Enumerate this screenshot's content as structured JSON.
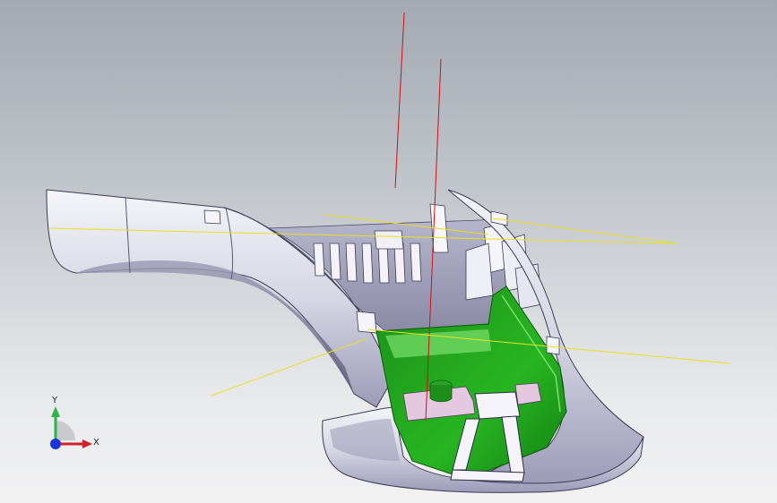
{
  "viewport": {
    "background_top": "#a3a9b2",
    "background_bottom": "#f2f2f3"
  },
  "model": {
    "shell_color": "#e4e4ef",
    "shell_shadow_color": "#7f7f9c",
    "inner_part_color": "#1f9e1c",
    "inner_highlight_color": "#7be06b",
    "pink_component_color": "#e3c8e0",
    "axis_line_color_red": "#d01010",
    "axis_line_color_yellow": "#e8e020"
  },
  "triad": {
    "x_label": "X",
    "y_label": "Y",
    "x_color": "#d0202a",
    "y_color": "#2db34a",
    "z_color": "#1a35d8"
  }
}
